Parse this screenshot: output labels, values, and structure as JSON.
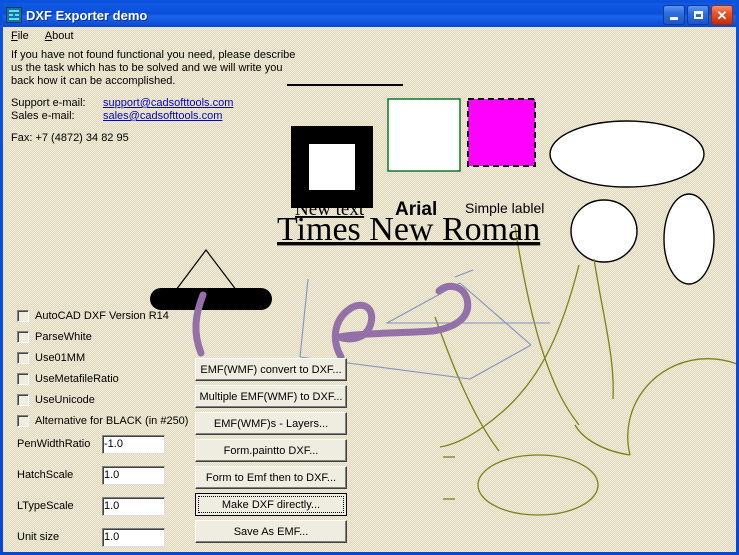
{
  "window": {
    "title": "DXF Exporter demo",
    "icon": "app-icon",
    "buttons": {
      "minimize": "minimize",
      "maximize": "maximize",
      "close": "close"
    }
  },
  "menu": {
    "items": [
      {
        "accel": "F",
        "rest": "ile"
      },
      {
        "accel": "A",
        "rest": "bout"
      }
    ]
  },
  "info": {
    "paragraph": [
      "If you have not found functional you need, please describe",
      "us the task which has to be solved and we will write you",
      "back how it can be accomplished."
    ],
    "support_label": "Support e-mail:",
    "support_email": "support@cadsofttools.com",
    "sales_label": "Sales e-mail:",
    "sales_email": "sales@cadsofttools.com",
    "fax": "Fax: +7 (4872) 34 82 95"
  },
  "options": {
    "checkboxes": [
      {
        "label": "AutoCAD DXF Version R14",
        "checked": false
      },
      {
        "label": "ParseWhite",
        "checked": false
      },
      {
        "label": "Use01MM",
        "checked": false
      },
      {
        "label": "UseMetafileRatio",
        "checked": false
      },
      {
        "label": "UseUnicode",
        "checked": false
      },
      {
        "label": "Alternative for BLACK (in #250)",
        "checked": false
      }
    ],
    "fields": [
      {
        "label": "PenWidthRatio",
        "value": "-1.0"
      },
      {
        "label": "HatchScale",
        "value": "1.0"
      },
      {
        "label": "LTypeScale",
        "value": "1.0"
      },
      {
        "label": "Unit size",
        "value": "1.0"
      }
    ]
  },
  "actions": {
    "buttons": [
      {
        "label": "EMF(WMF) convert to DXF...",
        "focused": false
      },
      {
        "label": "Multiple EMF(WMF) to DXF...",
        "focused": false
      },
      {
        "label": "EMF(WMF)s - Layers...",
        "focused": false
      },
      {
        "label": "Form.paintto DXF...",
        "focused": false
      },
      {
        "label": "Form to Emf then to DXF...",
        "focused": false
      },
      {
        "label": "Make DXF directly...",
        "focused": true
      },
      {
        "label": "Save As EMF...",
        "focused": false
      }
    ]
  },
  "canvas": {
    "shapes": {
      "square_black": {
        "name": "black-thick-square",
        "stroke": "#000000",
        "fill": "#ffffff",
        "stroke_width": 18
      },
      "square_green": {
        "name": "green-thin-square",
        "stroke": "#006b24",
        "fill": "#ffffff",
        "stroke_width": 1
      },
      "square_magenta": {
        "name": "magenta-dashed-square",
        "stroke": "#000000",
        "fill": "#ff00ff",
        "stroke_width": 2
      },
      "ellipse_wide": {
        "name": "wide-ellipse",
        "stroke": "#000000",
        "fill": "#ffffff"
      },
      "ellipse_round": {
        "name": "round-ellipse",
        "stroke": "#000000",
        "fill": "#ffffff"
      },
      "ellipse_tall": {
        "name": "tall-ellipse",
        "stroke": "#000000",
        "fill": "#ffffff"
      },
      "black_bar": {
        "name": "black-rounded-bar",
        "stroke": "#000000",
        "stroke_width": 22
      },
      "triangle": {
        "name": "thin-triangle",
        "stroke": "#000000",
        "stroke_width": 1
      },
      "purple_curve": {
        "name": "purple-freehand-curve",
        "stroke": "#9370a8",
        "stroke_width": 7
      },
      "blue_polygon": {
        "name": "blue-polyline",
        "stroke": "#8095c0",
        "stroke_width": 1
      },
      "olive_curves": {
        "name": "olive-curves",
        "stroke": "#80801a",
        "stroke_width": 1
      },
      "divider": {
        "name": "horizontal-rule",
        "stroke": "#000000",
        "stroke_width": 2
      }
    },
    "labels": {
      "new_text": "New text",
      "arial": "Arial",
      "simple_label": "Simple lablel",
      "times": "Times New Roman"
    }
  }
}
